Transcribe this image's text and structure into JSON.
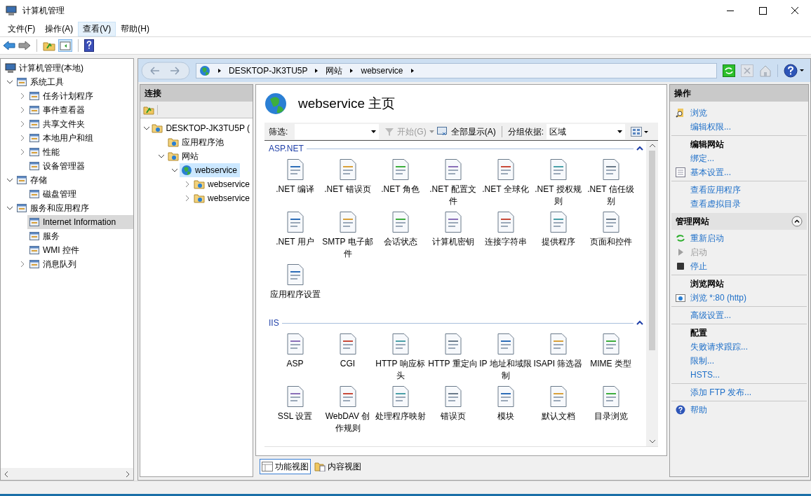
{
  "window": {
    "title": "计算机管理"
  },
  "menu": [
    {
      "label": "文件(F)",
      "selected": false
    },
    {
      "label": "操作(A)",
      "selected": false
    },
    {
      "label": "查看(V)",
      "selected": true
    },
    {
      "label": "帮助(H)",
      "selected": false
    }
  ],
  "tree": [
    {
      "label": "计算机管理(本地)",
      "selected": false,
      "children": [
        {
          "label": "系统工具",
          "expanded": true,
          "selected": false,
          "children": [
            {
              "label": "任务计划程序",
              "expanded": false,
              "selected": false
            },
            {
              "label": "事件查看器",
              "expanded": false,
              "selected": false
            },
            {
              "label": "共享文件夹",
              "expanded": false,
              "selected": false
            },
            {
              "label": "本地用户和组",
              "expanded": false,
              "selected": false
            },
            {
              "label": "性能",
              "expanded": false,
              "selected": false
            },
            {
              "label": "设备管理器",
              "selected": false
            }
          ]
        },
        {
          "label": "存储",
          "expanded": true,
          "selected": false,
          "children": [
            {
              "label": "磁盘管理",
              "selected": false
            }
          ]
        },
        {
          "label": "服务和应用程序",
          "expanded": true,
          "selected": false,
          "children": [
            {
              "label": "Internet Information",
              "selected": true
            },
            {
              "label": "服务",
              "selected": false
            },
            {
              "label": "WMI 控件",
              "selected": false
            },
            {
              "label": "消息队列",
              "expanded": false,
              "selected": false
            }
          ]
        }
      ]
    }
  ],
  "breadcrumb": [
    "DESKTOP-JK3TU5P",
    "网站",
    "webservice"
  ],
  "connections": {
    "title": "连接",
    "tree": [
      {
        "label": "DESKTOP-JK3TU5P (",
        "expanded": true,
        "selected": false,
        "children": [
          {
            "label": "应用程序池",
            "selected": false
          },
          {
            "label": "网站",
            "expanded": true,
            "selected": false,
            "children": [
              {
                "label": "webservice",
                "expanded": true,
                "selected": true,
                "children": [
                  {
                    "label": "webservice",
                    "expanded": false,
                    "selected": false
                  },
                  {
                    "label": "webservice",
                    "expanded": false,
                    "selected": false
                  }
                ]
              }
            ]
          }
        ]
      }
    ]
  },
  "page": {
    "title": "webservice 主页",
    "filter_label": "筛选:",
    "start": "开始(G)",
    "start_disabled": true,
    "show_all": "全部显示(A)",
    "group_label": "分组依据:",
    "group_value": "区域",
    "sections": [
      {
        "title": "ASP.NET",
        "expanded": true,
        "items": [
          ".NET 编译",
          ".NET 错误页",
          ".NET 角色",
          ".NET 配置文件",
          ".NET 全球化",
          ".NET 授权规则",
          ".NET 信任级别",
          ".NET 用户",
          "SMTP 电子邮件",
          "会话状态",
          "计算机密钥",
          "连接字符串",
          "提供程序",
          "页面和控件",
          "应用程序设置"
        ]
      },
      {
        "title": "IIS",
        "expanded": true,
        "items": [
          "ASP",
          "CGI",
          "HTTP 响应标头",
          "HTTP 重定向",
          "IP 地址和域限制",
          "ISAPI 筛选器",
          "MIME 类型",
          "SSL 设置",
          "WebDAV 创作规则",
          "处理程序映射",
          "错误页",
          "模块",
          "默认文档",
          "目录浏览"
        ]
      }
    ]
  },
  "view_tabs": [
    {
      "label": "功能视图",
      "selected": true
    },
    {
      "label": "内容视图",
      "selected": false
    }
  ],
  "actions": {
    "title": "操作",
    "groups": [
      {
        "items": [
          {
            "label": "浏览",
            "disabled": false
          },
          {
            "label": "编辑权限...",
            "disabled": false
          }
        ]
      },
      {
        "heading": "编辑网站",
        "items": [
          {
            "label": "绑定...",
            "disabled": false
          },
          {
            "label": "基本设置...",
            "disabled": false
          }
        ]
      },
      {
        "items": [
          {
            "label": "查看应用程序",
            "disabled": false
          },
          {
            "label": "查看虚拟目录",
            "disabled": false
          }
        ]
      }
    ]
  },
  "manage": {
    "title": "管理网站",
    "expanded": true,
    "groups": [
      {
        "items": [
          {
            "label": "重新启动",
            "disabled": false
          },
          {
            "label": "启动",
            "disabled": true
          },
          {
            "label": "停止",
            "disabled": false
          }
        ]
      },
      {
        "heading": "浏览网站",
        "items": [
          {
            "label": "浏览 *:80 (http)",
            "disabled": false
          }
        ]
      },
      {
        "items": [
          {
            "label": "高级设置...",
            "disabled": false
          }
        ]
      },
      {
        "heading": "配置",
        "items": [
          {
            "label": "失败请求跟踪...",
            "disabled": false
          },
          {
            "label": "限制...",
            "disabled": false
          },
          {
            "label": "HSTS...",
            "disabled": false
          }
        ]
      },
      {
        "items": [
          {
            "label": "添加 FTP 发布...",
            "disabled": false
          }
        ]
      },
      {
        "items": [
          {
            "label": "帮助",
            "disabled": false
          }
        ]
      }
    ]
  }
}
